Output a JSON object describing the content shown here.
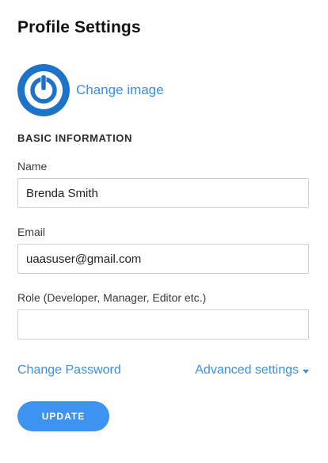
{
  "page": {
    "title": "Profile Settings"
  },
  "avatar": {
    "icon": "power-icon",
    "change_label": "Change image",
    "bg_color": "#1e73c8"
  },
  "basic_info": {
    "heading": "BASIC INFORMATION",
    "fields": [
      {
        "label": "Name",
        "value": "Brenda Smith",
        "placeholder": ""
      },
      {
        "label": "Email",
        "value": "uaasuser@gmail.com",
        "placeholder": ""
      },
      {
        "label": "Role (Developer, Manager, Editor etc.)",
        "value": "",
        "placeholder": ""
      }
    ]
  },
  "links": {
    "change_password": "Change Password",
    "advanced_settings": "Advanced settings",
    "advanced_icon": "caret-down-icon"
  },
  "actions": {
    "update_label": "UPDATE",
    "accent_color": "#3d93f0"
  }
}
